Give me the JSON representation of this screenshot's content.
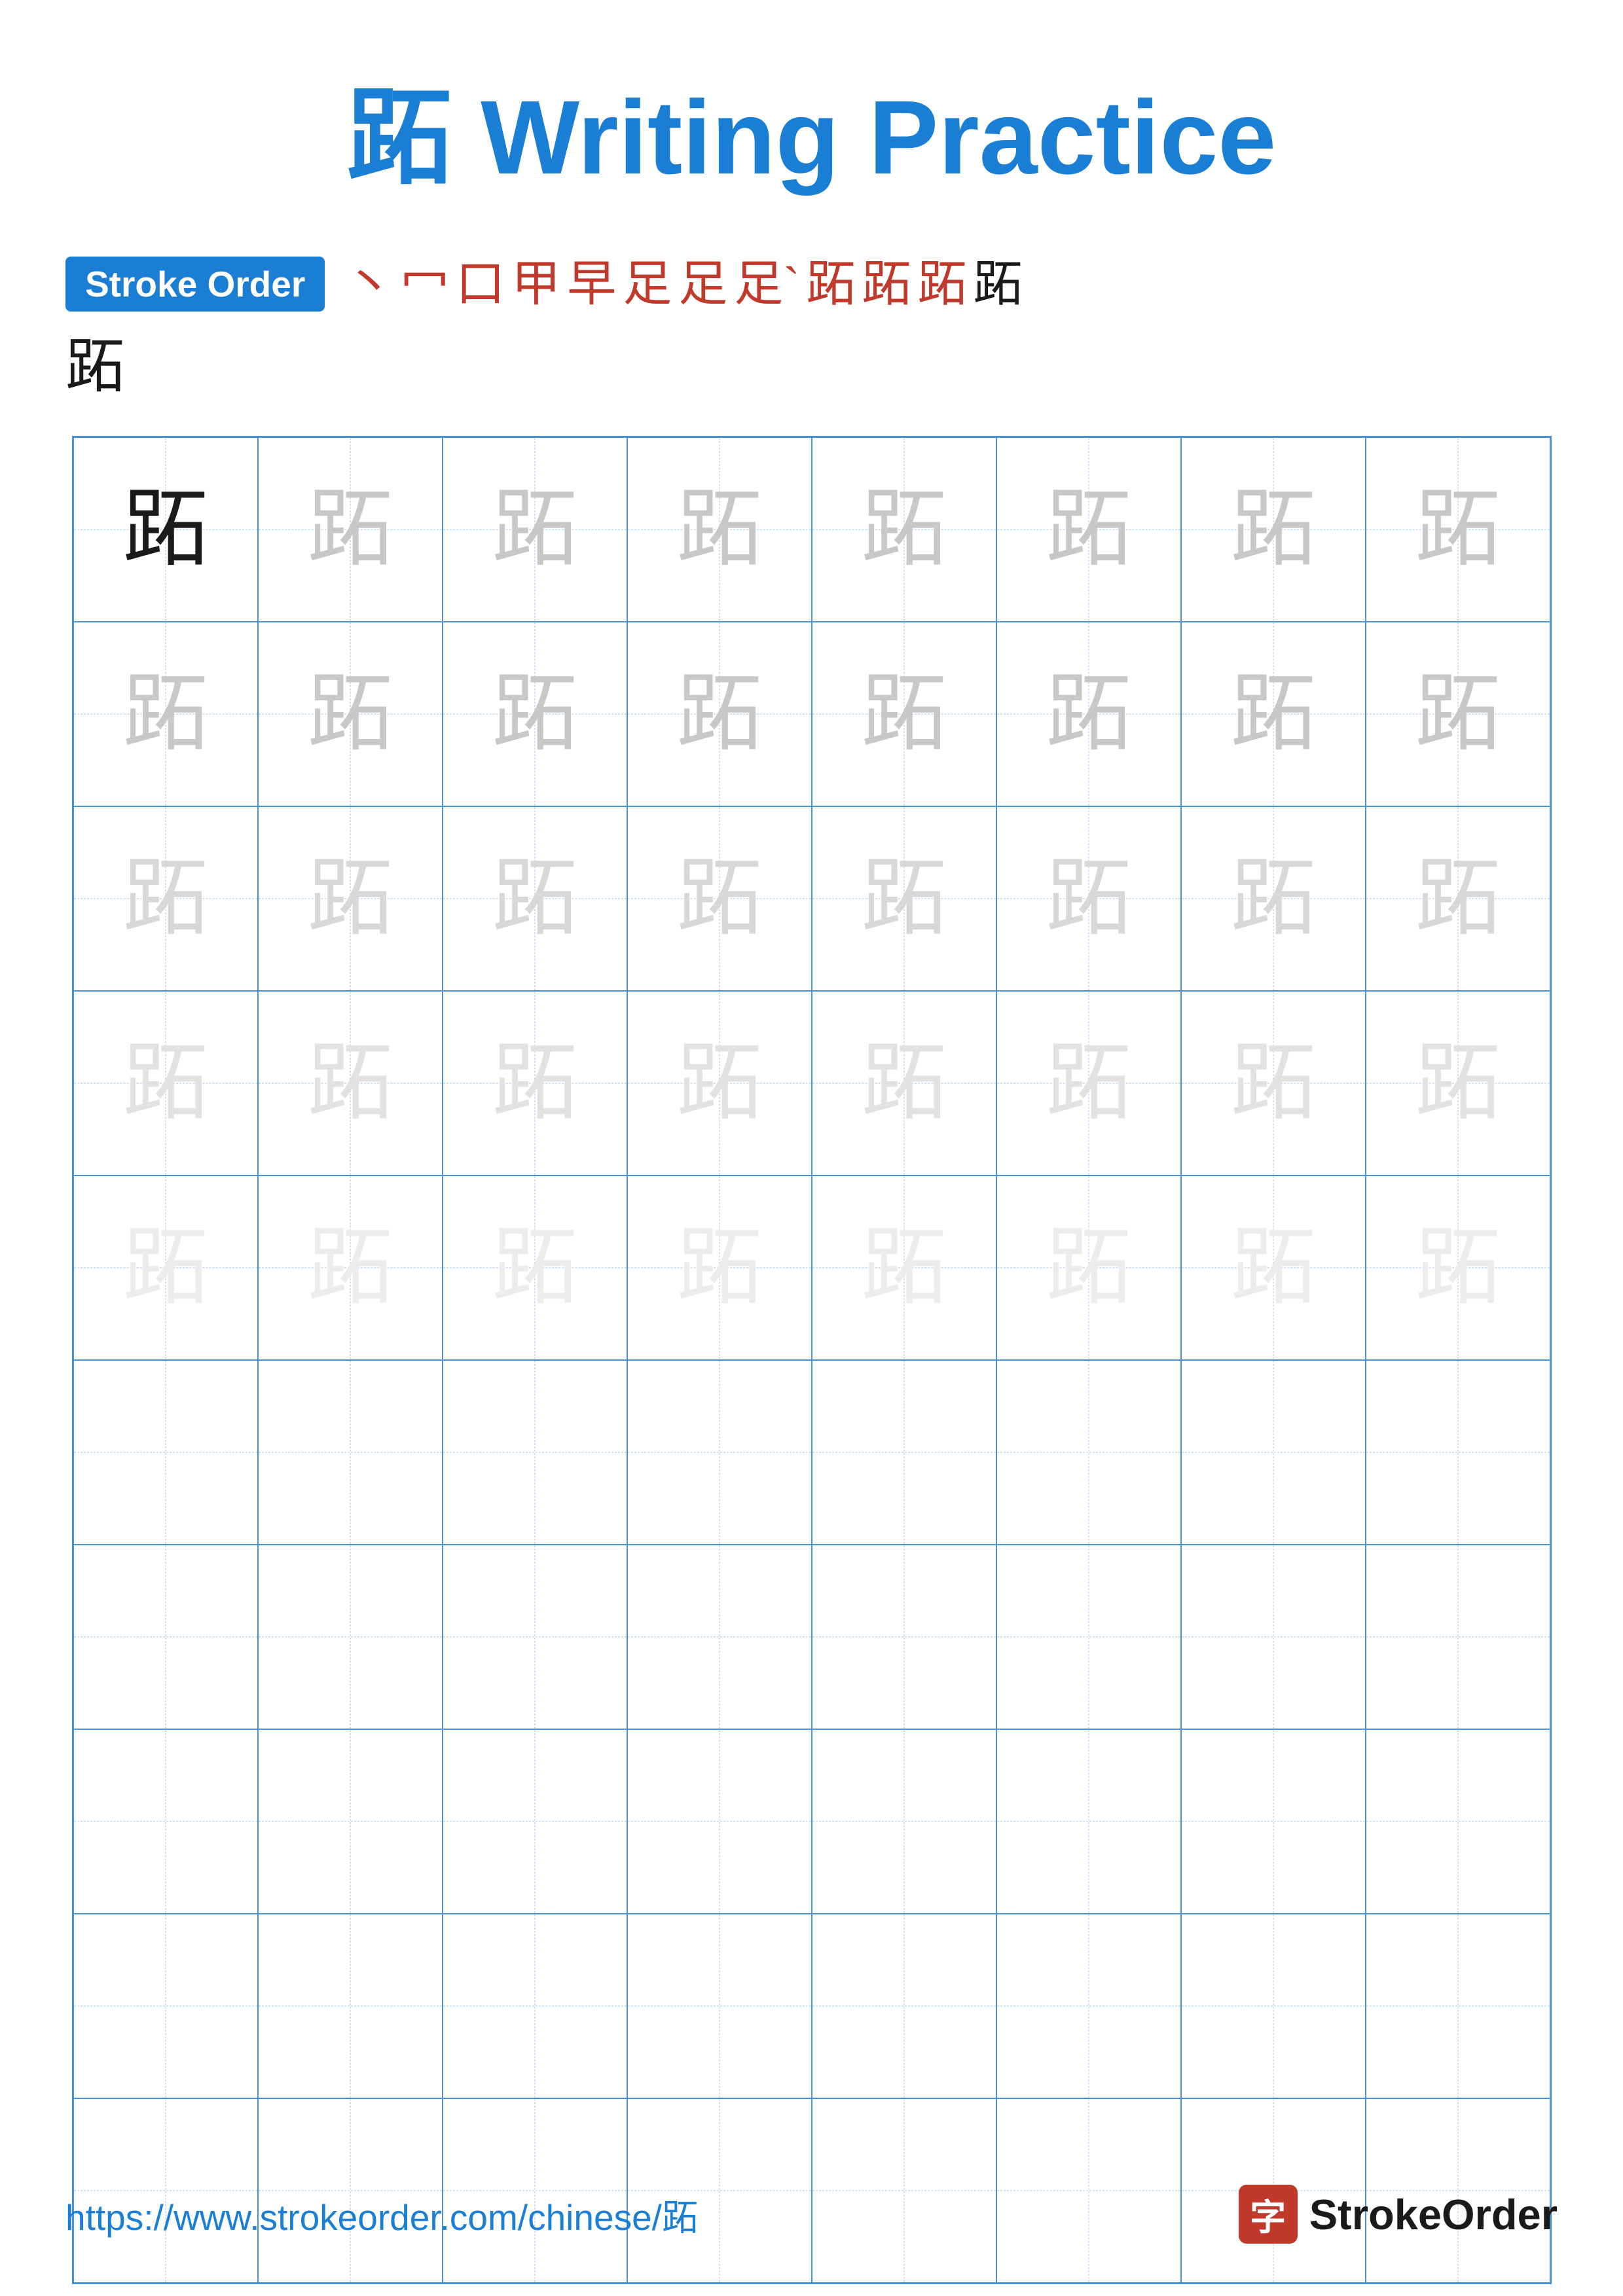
{
  "title": "跖 Writing Practice",
  "stroke_order": {
    "badge_label": "Stroke Order",
    "strokes": [
      "丶",
      "冖",
      "口",
      "甲",
      "早",
      "足",
      "足",
      "足`",
      "跖",
      "跖",
      "跖",
      "跖"
    ],
    "final_char": "跖"
  },
  "grid": {
    "character": "跖",
    "rows": 10,
    "cols": 8,
    "filled_rows": 5,
    "char_intensities": [
      "dark",
      "light1",
      "light2",
      "light3",
      "light4"
    ]
  },
  "footer": {
    "url": "https://www.strokeorder.com/chinese/跖",
    "brand_char": "字",
    "brand_name": "StrokeOrder"
  }
}
